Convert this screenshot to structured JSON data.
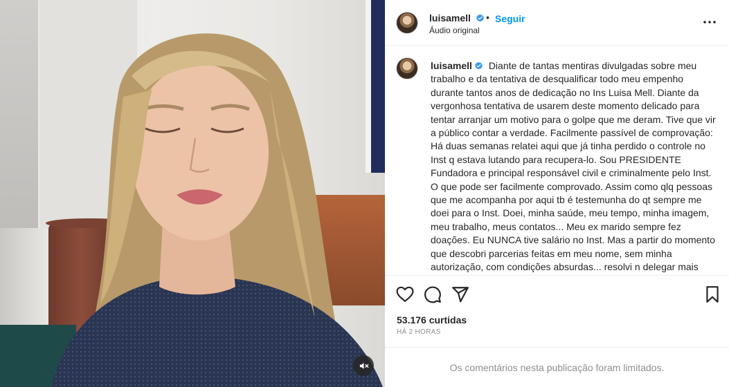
{
  "media": {
    "mute_icon": "speaker-muted-icon"
  },
  "header": {
    "username": "luisamell",
    "verified": true,
    "separator": "•",
    "follow_label": "Seguir",
    "audio_label": "Áudio original",
    "more_icon": "more-horizontal-icon"
  },
  "caption": {
    "username": "luisamell",
    "text": "Diante de tantas mentiras divulgadas sobre meu trabalho e da tentativa de desqualificar todo meu empenho durante tantos anos de dedicação no Ins Luisa Mell. Diante da vergonhosa tentativa de usarem deste momento delicado para tentar arranjar um motivo para o golpe que me deram. Tive que vir a público contar a verdade. Facilmente passível de comprovação: Há duas semanas relatei aqui que já tinha perdido o controle no Inst q estava lutando para recupera-lo. Sou PRESIDENTE Fundadora e principal responsável civil e criminalmente pelo Inst. O que pode ser facilmente comprovado. Assim como qlq pessoas que me acompanha por aqui tb é testemunha do qt sempre me doei para o Inst. Doei, minha saúde, meu tempo, minha imagem, meu trabalho, meus contatos... Meu ex marido sempre fez doações. Eu NUNCA tive salário no Inst. Mas a partir do momento que descobri parcerias feitas em meu nome, sem minha autorização, com condições absurdas... resolvi n delegar mais"
  },
  "actions": {
    "like_icon": "heart-icon",
    "comment_icon": "comment-icon",
    "share_icon": "paper-plane-icon",
    "save_icon": "bookmark-icon"
  },
  "stats": {
    "likes": "53.176 curtidas",
    "time": "HÁ 2 HORAS"
  },
  "comments_notice": "Os comentários nesta publicação foram limitados.",
  "colors": {
    "accent": "#0095f6",
    "verified": "#3897f0",
    "muted_text": "#8e8e8e"
  }
}
